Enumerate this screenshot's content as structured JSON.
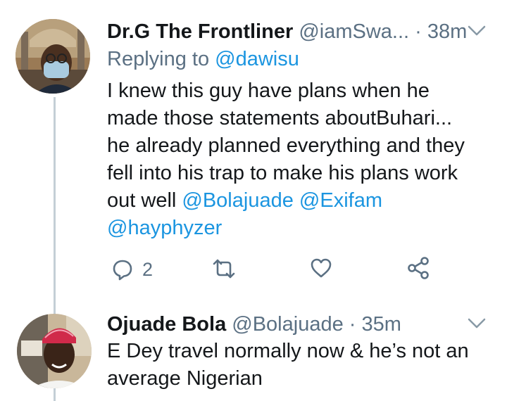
{
  "tweet1": {
    "display_name": "Dr.G The Frontliner",
    "handle": "@iamSwa...",
    "separator": "·",
    "time": "38m",
    "replying_prefix": "Replying to",
    "replying_handle": "@dawisu",
    "text_1": "I knew this guy have plans when he",
    "text_2": "made those statements aboutBuhari...",
    "text_3": "he already planned everything and they",
    "text_4": "fell into his trap to make his plans work",
    "text_5": "out well",
    "mention_1": "@Bolajuade",
    "mention_2": "@Exifam",
    "mention_3": "@hayphyzer",
    "reply_count": "2"
  },
  "tweet2": {
    "display_name": "Ojuade Bola",
    "handle": "@Bolajuade",
    "separator": "·",
    "time": "35m",
    "text_1": "E Dey travel normally now & he’s not an",
    "text_2": "average Nigerian"
  },
  "colors": {
    "link": "#1b95e0",
    "muted": "#5b7083",
    "thread_line": "#c4cfd6"
  },
  "icons": [
    "reply-icon",
    "retweet-icon",
    "like-icon",
    "share-icon",
    "chevron-down-icon"
  ]
}
